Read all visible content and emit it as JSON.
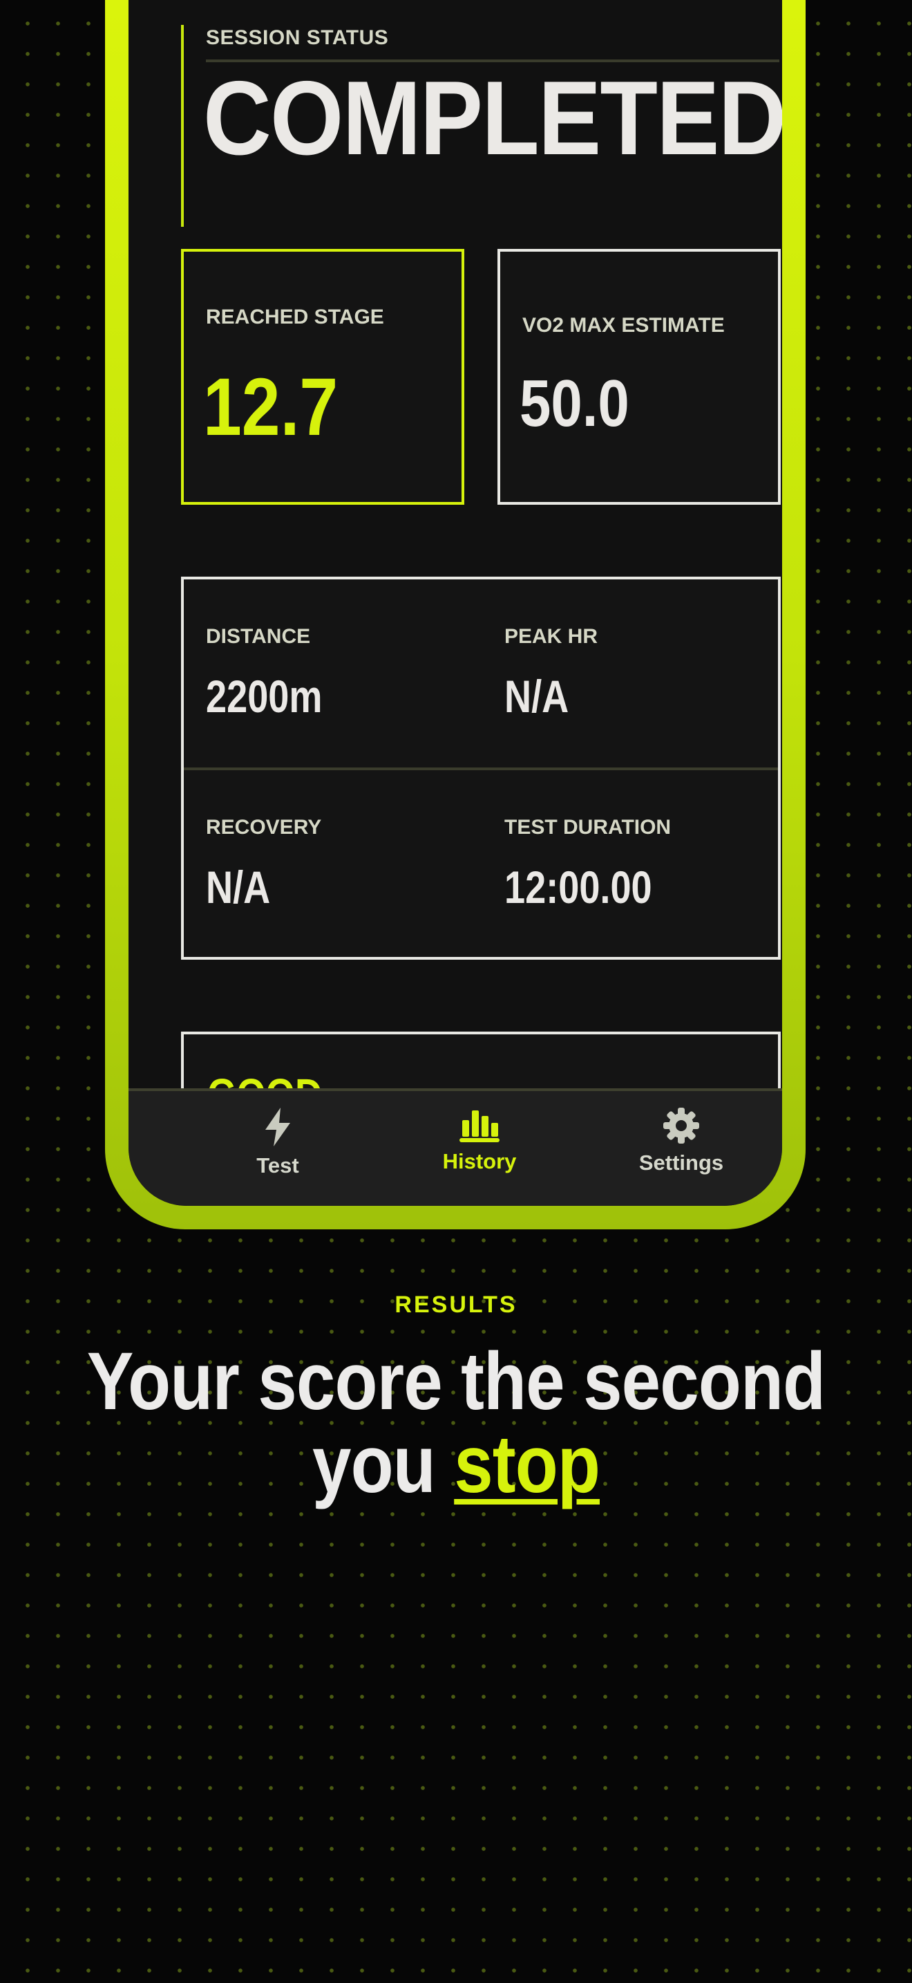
{
  "session": {
    "label": "SESSION STATUS",
    "value": "COMPLETED"
  },
  "cards": {
    "reached_stage": {
      "label": "REACHED STAGE",
      "value": "12.7"
    },
    "vo2max": {
      "label": "VO2 MAX ESTIMATE",
      "value": "50.0"
    }
  },
  "metrics": {
    "distance": {
      "label": "DISTANCE",
      "value": "2200m"
    },
    "peak_hr": {
      "label": "PEAK HR",
      "value": "N/A"
    },
    "recovery": {
      "label": "RECOVERY",
      "value": "N/A"
    },
    "test_duration": {
      "label": "TEST DURATION",
      "value": "12:00.00"
    }
  },
  "rating": {
    "value": "GOOD"
  },
  "tabbar": {
    "tabs": [
      {
        "label": "Test",
        "icon": "bolt-icon",
        "active": false
      },
      {
        "label": "History",
        "icon": "bar-chart-icon",
        "active": true
      },
      {
        "label": "Settings",
        "icon": "gear-icon",
        "active": false
      }
    ]
  },
  "marketing": {
    "eyebrow": "RESULTS",
    "headline_line1": "Your score the second",
    "headline_line2_prefix": "you",
    "headline_line2_highlight": "stop"
  },
  "colors": {
    "accent": "#d6f20c",
    "background": "#060606",
    "card": "#141414",
    "text": "#ebe9e6"
  }
}
